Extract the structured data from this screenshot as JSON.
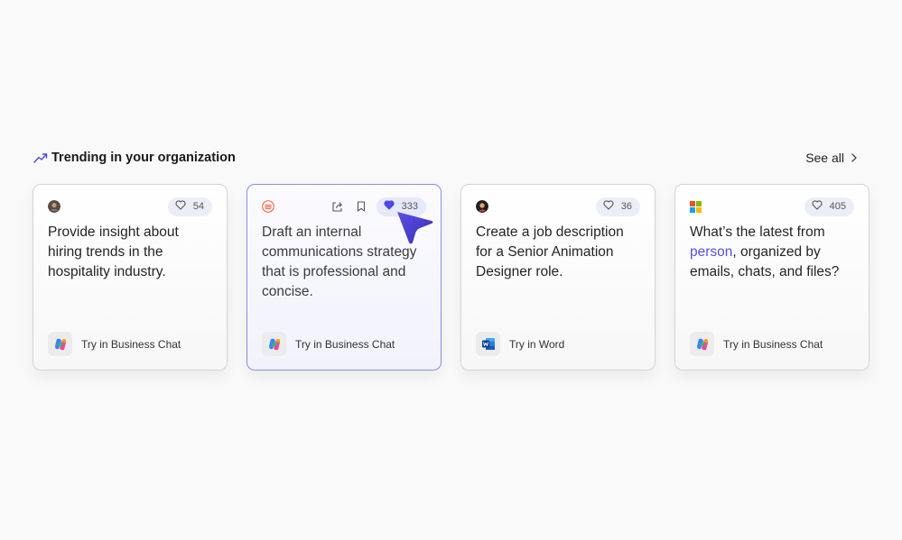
{
  "section": {
    "title": "Trending in your organization",
    "see_all": "See all"
  },
  "colors": {
    "accent": "#4f46e5",
    "mention": "#5b4fe0",
    "active_border": "#8a8fe0"
  },
  "cards": [
    {
      "avatar_icon": "person-avatar-icon",
      "likes": "54",
      "liked": false,
      "prompt": "Provide insight about hiring trends in the hospitality industry.",
      "app_icon": "copilot-icon",
      "action_label": "Try in Business Chat"
    },
    {
      "avatar_icon": "org-logo-icon",
      "likes": "333",
      "liked": true,
      "prompt": "Draft an internal communications strategy that is professional and concise.",
      "app_icon": "copilot-icon",
      "action_label": "Try in Business Chat",
      "active": true
    },
    {
      "avatar_icon": "person-avatar-icon",
      "likes": "36",
      "liked": false,
      "prompt": "Create a job description for a Senior Animation Designer role.",
      "app_icon": "word-icon",
      "action_label": "Try in Word"
    },
    {
      "avatar_icon": "microsoft-logo-icon",
      "likes": "405",
      "liked": false,
      "prompt_before": "What’s the latest from ",
      "prompt_mention": "person",
      "prompt_after": ", organized by emails, chats, and files?",
      "app_icon": "copilot-icon",
      "action_label": "Try in Business Chat"
    }
  ]
}
